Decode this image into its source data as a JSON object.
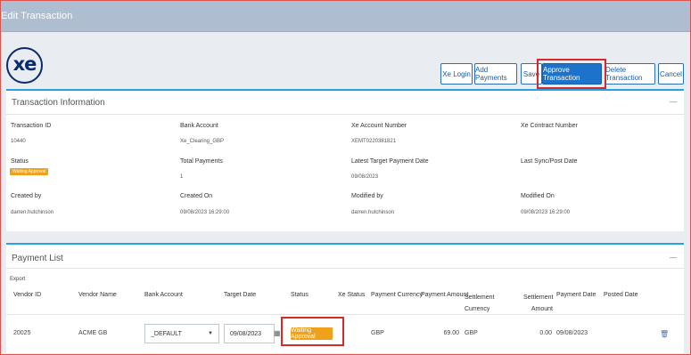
{
  "window": {
    "title": "Edit Transaction"
  },
  "logo": {
    "text": "xe"
  },
  "toolbar": {
    "xe_login": "Xe Login",
    "add_payments": "Add Payments",
    "save": "Save",
    "approve": "Approve Transaction",
    "delete": "Delete Transaction",
    "cancel": "Cancel"
  },
  "transaction_info": {
    "title": "Transaction Information",
    "collapse": "—",
    "fields": {
      "transaction_id": {
        "label": "Transaction ID",
        "value": "10440"
      },
      "bank_account": {
        "label": "Bank Account",
        "value": "Xe_Clearing_GBP"
      },
      "xe_account_number": {
        "label": "Xe Account Number",
        "value": "XEMT0220381821"
      },
      "xe_contract_number": {
        "label": "Xe Contract Number",
        "value": ""
      },
      "status": {
        "label": "Status",
        "value": "Waiting Approval"
      },
      "total_payments": {
        "label": "Total Payments",
        "value": "1"
      },
      "latest_target_payment_date": {
        "label": "Latest Target Payment Date",
        "value": "09/08/2023"
      },
      "last_sync": {
        "label": "Last Sync/Post Date",
        "value": ""
      },
      "created_by": {
        "label": "Created by",
        "value": "darren.hutchinson"
      },
      "created_on": {
        "label": "Created On",
        "value": "09/08/2023 16:29:00"
      },
      "modified_by": {
        "label": "Modified by",
        "value": "darren.hutchinson"
      },
      "modified_on": {
        "label": "Modified On",
        "value": "09/08/2023 16:29:00"
      }
    }
  },
  "payment_list": {
    "title": "Payment List",
    "collapse": "—",
    "export": "Export",
    "columns": [
      "Vendor ID",
      "Vendor Name",
      "Bank Account",
      "Target Date",
      "Status",
      "Xe Status",
      "Payment Currency",
      "Payment Amount",
      "Settlement Currency",
      "Settlement Amount",
      "Payment Date",
      "Posted Date"
    ],
    "rows": [
      {
        "vendor_id": "20025",
        "vendor_name": "ACME GB",
        "bank_account": "_DEFAULT",
        "target_date": "09/08/2023",
        "status": "Waiting Approval",
        "xe_status": "",
        "payment_currency": "GBP",
        "payment_amount": "69.00",
        "settlement_currency": "GBP",
        "settlement_amount": "0.00",
        "payment_date": "09/08/2023",
        "posted_date": ""
      }
    ]
  },
  "colors": {
    "accent": "#1c73c9",
    "panel_border": "#2aa0e0",
    "status_badge": "#f0a11b",
    "highlight": "#d42a2a",
    "titlebar": "#aebdd0"
  }
}
